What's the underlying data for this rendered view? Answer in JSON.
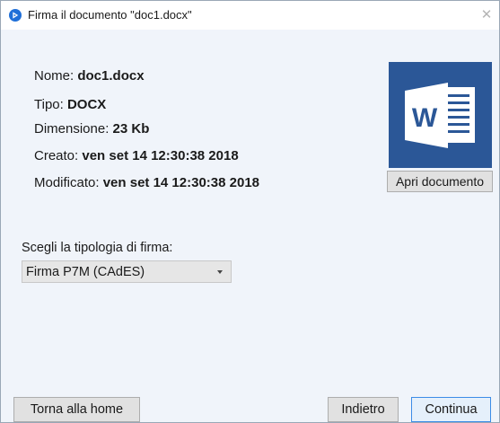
{
  "window": {
    "title": "Firma il documento \"doc1.docx\"",
    "close_glyph": "✕"
  },
  "info": {
    "name_label": "Nome:",
    "name_value": "doc1.docx",
    "type_label": "Tipo:",
    "type_value": "DOCX",
    "size_label": "Dimensione:",
    "size_value": "23 Kb",
    "created_label": "Creato:",
    "created_value": "ven set 14 12:30:38 2018",
    "modified_label": "Modificato:",
    "modified_value": "ven set 14 12:30:38 2018"
  },
  "document_preview": {
    "icon": "word-document-icon",
    "letter": "W",
    "open_button_label": "Apri documento"
  },
  "signature": {
    "label": "Scegli la tipologia di firma:",
    "selected": "Firma P7M (CAdES)"
  },
  "footer": {
    "home_label": "Torna alla home",
    "back_label": "Indietro",
    "next_label": "Continua"
  },
  "colors": {
    "word_blue": "#2b5797",
    "app_icon_blue": "#1f6fd8",
    "primary_border": "#3c8ce7"
  }
}
